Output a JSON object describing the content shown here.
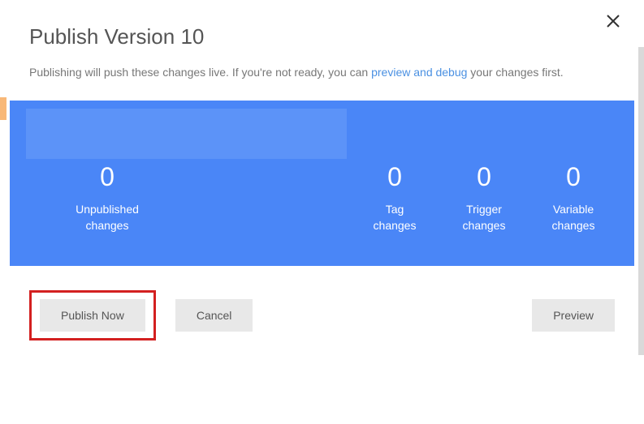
{
  "dialog": {
    "title": "Publish Version 10",
    "description_pre": "Publishing will push these changes live. If you're not ready, you can ",
    "description_link": "preview and debug",
    "description_post": " your changes first."
  },
  "stats": {
    "unpublished": {
      "value": "0",
      "label1": "Unpublished",
      "label2": "changes"
    },
    "tag": {
      "value": "0",
      "label1": "Tag",
      "label2": "changes"
    },
    "trigger": {
      "value": "0",
      "label1": "Trigger",
      "label2": "changes"
    },
    "variable": {
      "value": "0",
      "label1": "Variable",
      "label2": "changes"
    }
  },
  "buttons": {
    "publish": "Publish Now",
    "cancel": "Cancel",
    "preview": "Preview"
  }
}
